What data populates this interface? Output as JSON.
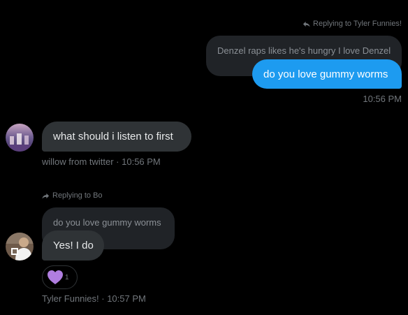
{
  "thread": {
    "top_reply": {
      "reply_label": "Replying to Tyler Funnies!",
      "quoted_text": "Denzel raps likes he's hungry I love Denzel",
      "message": "do you love gummy worms",
      "timestamp": "10:56 PM"
    },
    "willow_message": {
      "message": "what should i listen to first",
      "meta": "willow from twitter · 10:56 PM",
      "avatar_icon": "avatar-willow-photo"
    },
    "tyler_reply": {
      "reply_label": "Replying to Bo",
      "quoted_text": "do you love gummy worms",
      "message": "Yes! I do",
      "reaction": {
        "icon": "purple-heart",
        "count": "1",
        "color": "#b07ee0"
      },
      "meta": "Tyler Funnies! · 10:57 PM",
      "avatar_icon": "avatar-tyler-photo"
    }
  },
  "colors": {
    "background": "#000000",
    "sent_bubble": "#1d9bf0",
    "received_bubble": "#2f3336",
    "quoted_bubble": "#202327",
    "muted_text": "#71767b"
  }
}
